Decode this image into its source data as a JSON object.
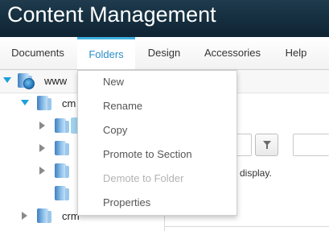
{
  "app": {
    "title": "Content Management"
  },
  "menu": {
    "items": [
      {
        "label": "Documents"
      },
      {
        "label": "Folders",
        "active": true
      },
      {
        "label": "Design"
      },
      {
        "label": "Accessories"
      },
      {
        "label": "Help"
      }
    ]
  },
  "tree": {
    "root": {
      "label": "www"
    },
    "child": {
      "label": "cm"
    },
    "sibling": {
      "label": "crm"
    }
  },
  "dropdown": {
    "items": [
      {
        "label": "New",
        "enabled": true
      },
      {
        "label": "Rename",
        "enabled": true
      },
      {
        "label": "Copy",
        "enabled": true
      },
      {
        "label": "Promote to Section",
        "enabled": true
      },
      {
        "label": "Demote to Folder",
        "enabled": false
      },
      {
        "label": "Properties",
        "enabled": true
      }
    ]
  },
  "content": {
    "message_fragment": "display."
  },
  "colors": {
    "titlebar": "#163041",
    "accent": "#3fb0de",
    "active_menu_text": "#2a8fc6",
    "disabled_text": "#b3b3b3"
  },
  "icons": {
    "filter": "funnel-icon",
    "folder": "folder-icon",
    "site": "globe-icon"
  }
}
